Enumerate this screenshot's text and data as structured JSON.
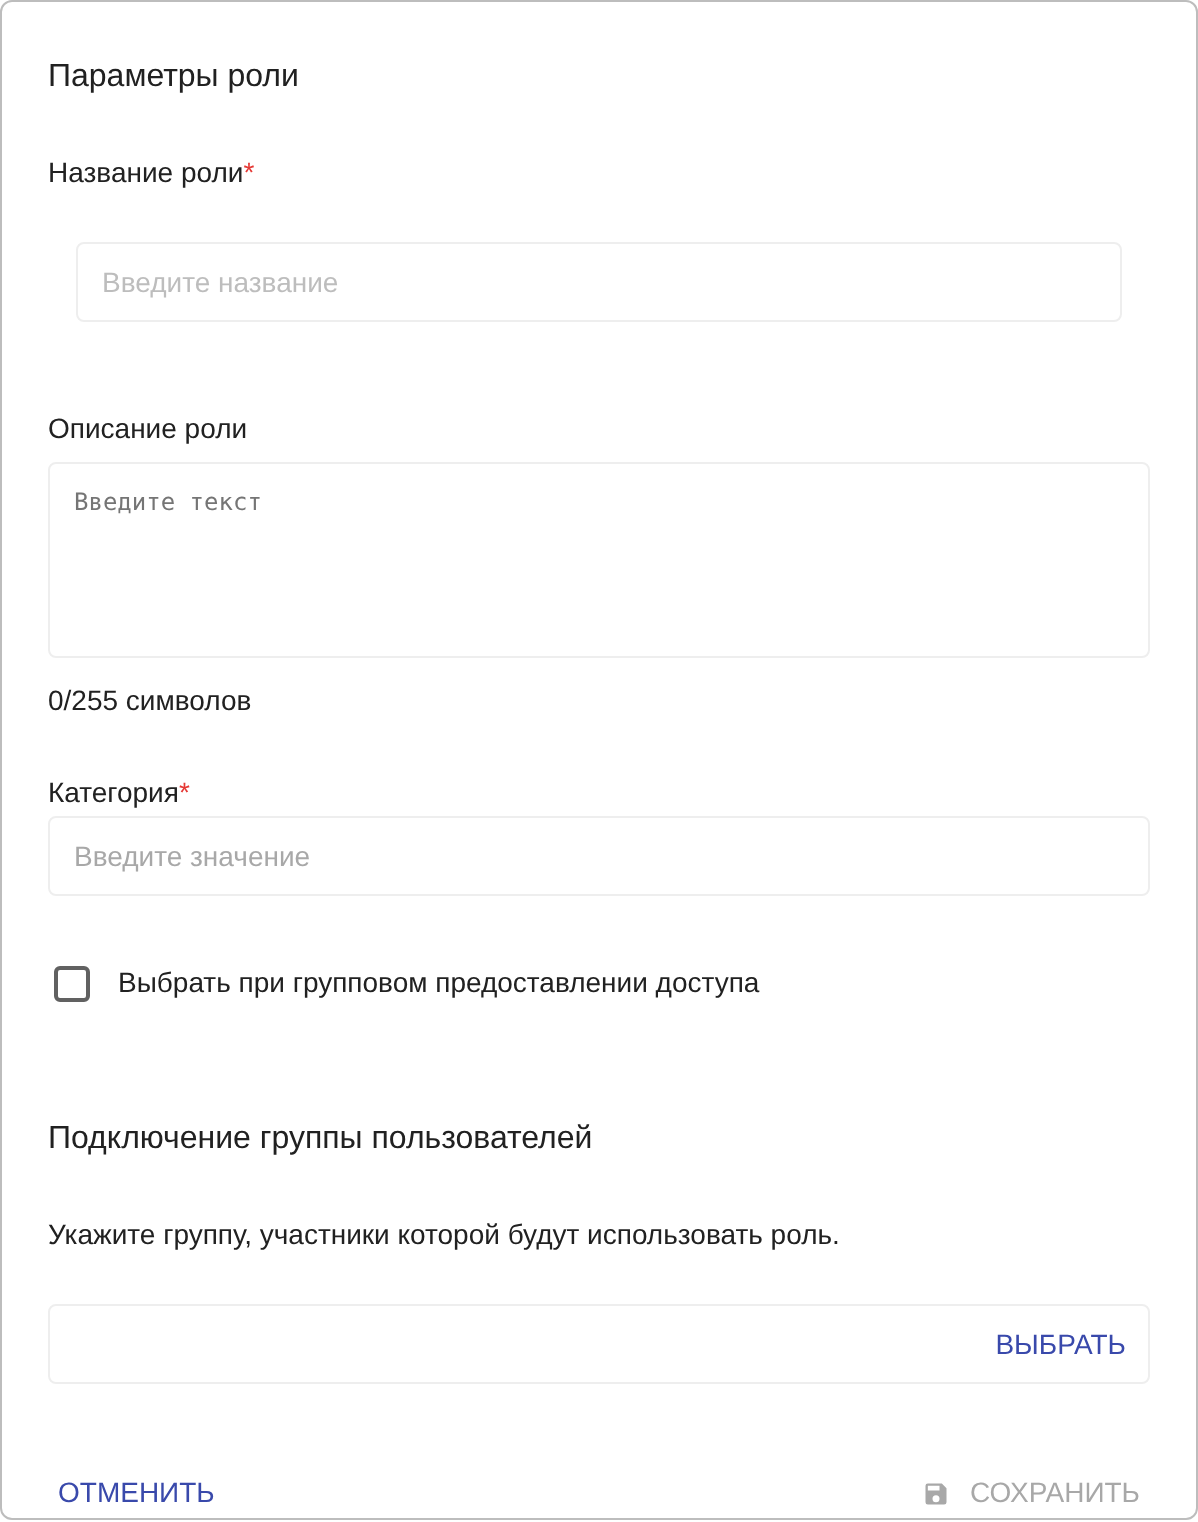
{
  "title": "Параметры роли",
  "name_field": {
    "label": "Название роли",
    "required_mark": "*",
    "placeholder": "Введите название"
  },
  "description_field": {
    "label": "Описание роли",
    "placeholder": "Введите текст",
    "counter": "0/255 символов"
  },
  "category_field": {
    "label": "Категория",
    "required_mark": "*",
    "placeholder": "Введите значение"
  },
  "group_access_checkbox": {
    "label": "Выбрать при групповом предоставлении доступа",
    "checked": false
  },
  "user_group_section": {
    "title": "Подключение группы пользователей",
    "hint": "Укажите группу, участники которой будут использовать роль.",
    "select_button": "ВЫБРАТЬ"
  },
  "footer": {
    "cancel": "ОТМЕНИТЬ",
    "save": {
      "label": "СОХРАНИТЬ",
      "disabled": true
    }
  }
}
